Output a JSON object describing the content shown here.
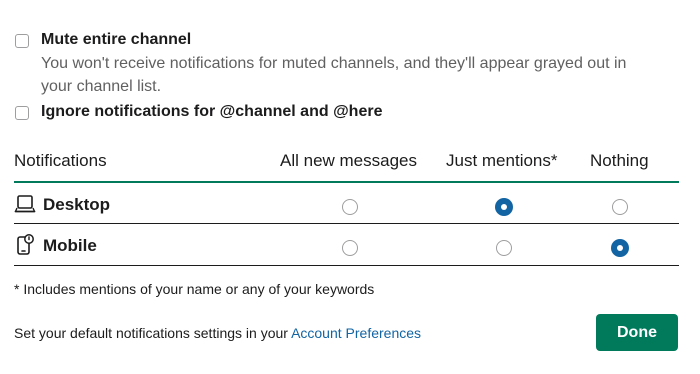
{
  "options": {
    "mute": {
      "checked": false,
      "title": "Mute entire channel",
      "description": "You won't receive notifications for muted channels, and they'll appear grayed out in your channel list."
    },
    "ignore": {
      "checked": false,
      "title": "Ignore notifications for @channel and @here"
    }
  },
  "table": {
    "headers": [
      "Notifications",
      "All new messages",
      "Just mentions*",
      "Nothing"
    ],
    "rows": [
      {
        "label": "Desktop",
        "icon": "laptop-icon",
        "selected": "Just mentions*"
      },
      {
        "label": "Mobile",
        "icon": "mobile-notification-icon",
        "selected": "Nothing"
      }
    ]
  },
  "note": "* Includes mentions of your name or any of your keywords",
  "footer": {
    "text": "Set your default notifications settings in your",
    "link": "Account Preferences",
    "done": "Done"
  },
  "colors": {
    "accent_green": "#007a5a",
    "link_blue": "#1264a3",
    "divider_green": "#007a5a"
  }
}
